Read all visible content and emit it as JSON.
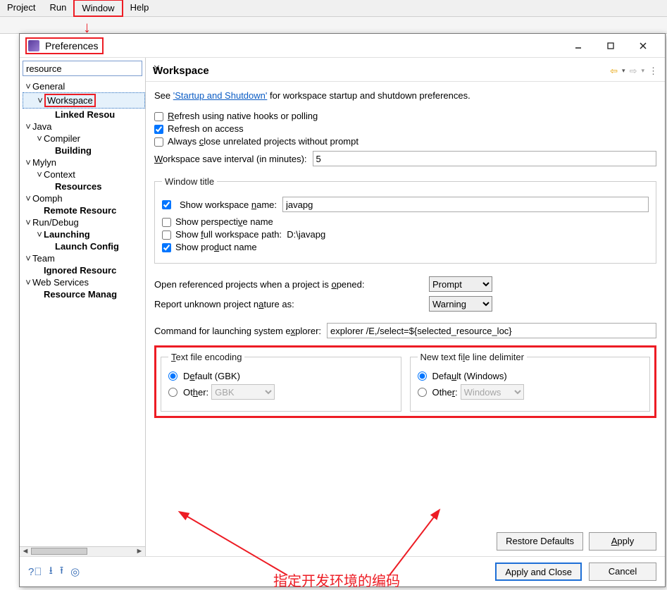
{
  "menubar": {
    "items": [
      "Project",
      "Run",
      "Window",
      "Help"
    ],
    "highlighted_index": 2
  },
  "dialog": {
    "title": "Preferences",
    "search": {
      "value": "resource"
    },
    "tree": [
      {
        "level": 0,
        "label": "General",
        "twisty": "v"
      },
      {
        "level": 1,
        "label": "Workspace",
        "twisty": "v",
        "selected": true,
        "hlred": true
      },
      {
        "level": 2,
        "label": "Linked Resou",
        "bold": true
      },
      {
        "level": 0,
        "label": "Java",
        "twisty": "v"
      },
      {
        "level": 1,
        "label": "Compiler",
        "twisty": "v"
      },
      {
        "level": 2,
        "label": "Building",
        "bold": true
      },
      {
        "level": 0,
        "label": "Mylyn",
        "twisty": "v"
      },
      {
        "level": 1,
        "label": "Context",
        "twisty": "v"
      },
      {
        "level": 2,
        "label": "Resources",
        "bold": true
      },
      {
        "level": 0,
        "label": "Oomph",
        "twisty": "v"
      },
      {
        "level": 1,
        "label": "Remote Resourc",
        "bold": true
      },
      {
        "level": 0,
        "label": "Run/Debug",
        "twisty": "v"
      },
      {
        "level": 1,
        "label": "Launching",
        "twisty": "v",
        "bold": true
      },
      {
        "level": 2,
        "label": "Launch Config",
        "bold": true
      },
      {
        "level": 0,
        "label": "Team",
        "twisty": "v"
      },
      {
        "level": 1,
        "label": "Ignored Resourc",
        "bold": true
      },
      {
        "level": 0,
        "label": "Web Services",
        "twisty": "v"
      },
      {
        "level": 1,
        "label": "Resource Manag",
        "bold": true
      }
    ],
    "page": {
      "heading": "Workspace",
      "desc_prefix": "See ",
      "desc_link": "'Startup and Shutdown'",
      "desc_suffix": " for workspace startup and shutdown preferences.",
      "chk_refresh_hooks": "Refresh using native hooks or polling",
      "chk_refresh_access": "Refresh on access",
      "chk_close_unrelated": "Always close unrelated projects without prompt",
      "lbl_save_interval": "Workspace save interval (in minutes):",
      "val_save_interval": "5",
      "grp_window_title": "Window title",
      "chk_show_ws_name": "Show workspace name:",
      "val_ws_name": "javapg",
      "chk_show_perspective": "Show perspective name",
      "chk_show_full_path": "Show full workspace path:",
      "val_full_path": "D:\\javapg",
      "chk_show_product": "Show product name",
      "lbl_open_ref": "Open referenced projects when a project is opened:",
      "val_open_ref": "Prompt",
      "lbl_unknown_nature": "Report unknown project nature as:",
      "val_unknown_nature": "Warning",
      "lbl_cmd": "Command for launching system explorer:",
      "val_cmd": "explorer /E,/select=${selected_resource_loc}",
      "grp_encoding": "Text file encoding",
      "enc_default": "Default (GBK)",
      "enc_other_label": "Other:",
      "enc_other_value": "GBK",
      "grp_linedelim": "New text file line delimiter",
      "ld_default": "Default (Windows)",
      "ld_other_label": "Other:",
      "ld_other_value": "Windows"
    },
    "buttons": {
      "restore": "Restore Defaults",
      "apply": "Apply",
      "apply_close": "Apply and Close",
      "cancel": "Cancel"
    }
  },
  "annotation": {
    "text": "指定开发环境的编码"
  }
}
